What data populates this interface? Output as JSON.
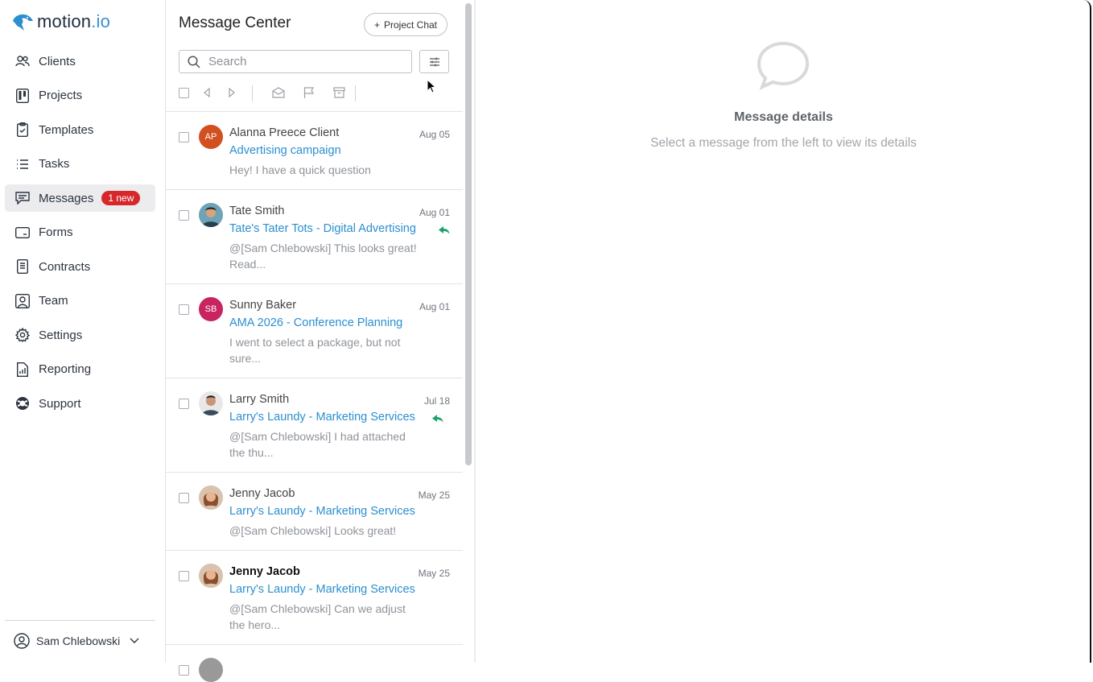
{
  "app": {
    "logo_main": "motion",
    "logo_suffix": ".io"
  },
  "sidebar": {
    "items": [
      {
        "label": "Clients",
        "icon": "users-icon"
      },
      {
        "label": "Projects",
        "icon": "kanban-icon"
      },
      {
        "label": "Templates",
        "icon": "clipboard-icon"
      },
      {
        "label": "Tasks",
        "icon": "list-icon"
      },
      {
        "label": "Messages",
        "icon": "chat-icon",
        "badge": "1 new",
        "active": true
      },
      {
        "label": "Forms",
        "icon": "form-icon"
      },
      {
        "label": "Contracts",
        "icon": "document-icon"
      },
      {
        "label": "Team",
        "icon": "team-icon"
      },
      {
        "label": "Settings",
        "icon": "gear-icon"
      },
      {
        "label": "Reporting",
        "icon": "report-icon"
      },
      {
        "label": "Support",
        "icon": "lifebuoy-icon"
      }
    ],
    "user_name": "Sam Chlebowski"
  },
  "message_center": {
    "title": "Message Center",
    "project_chat_label": "Project Chat",
    "search_placeholder": "Search",
    "messages": [
      {
        "initials": "AP",
        "avatar_color": "#d2501f",
        "sender": "Alanna Preece Client",
        "date": "Aug 05",
        "subject": "Advertising campaign",
        "preview": "Hey! I have a quick question",
        "replied": false,
        "bold": false
      },
      {
        "initials": "",
        "avatar_color": "#3a5a6e",
        "sender": "Tate Smith",
        "date": "Aug 01",
        "subject": "Tate's Tater Tots - Digital Advertising",
        "preview": "@[Sam Chlebowski] This looks great! Read...",
        "replied": true,
        "bold": false
      },
      {
        "initials": "SB",
        "avatar_color": "#c8245f",
        "sender": "Sunny Baker",
        "date": "Aug 01",
        "subject": "AMA 2026 - Conference Planning",
        "preview": "I went to select a package, but not sure...",
        "replied": false,
        "bold": false
      },
      {
        "initials": "",
        "avatar_color": "#7a6a5c",
        "sender": "Larry Smith",
        "date": "Jul 18",
        "subject": "Larry's Laundy - Marketing Services",
        "preview": "@[Sam Chlebowski] I had attached the thu...",
        "replied": true,
        "bold": false
      },
      {
        "initials": "",
        "avatar_color": "#a8704c",
        "sender": "Jenny Jacob",
        "date": "May 25",
        "subject": "Larry's Laundy - Marketing Services",
        "preview": "@[Sam Chlebowski] Looks great!",
        "replied": false,
        "bold": false
      },
      {
        "initials": "",
        "avatar_color": "#a8704c",
        "sender": "Jenny Jacob",
        "date": "May 25",
        "subject": "Larry's Laundy - Marketing Services",
        "preview": "@[Sam Chlebowski] Can we adjust the hero...",
        "replied": false,
        "bold": true
      }
    ]
  },
  "detail": {
    "title": "Message details",
    "subtitle": "Select a message from the left to view its details"
  },
  "colors": {
    "accent": "#2b8fcf",
    "badge": "#d6282b",
    "reply": "#1aa36b"
  }
}
